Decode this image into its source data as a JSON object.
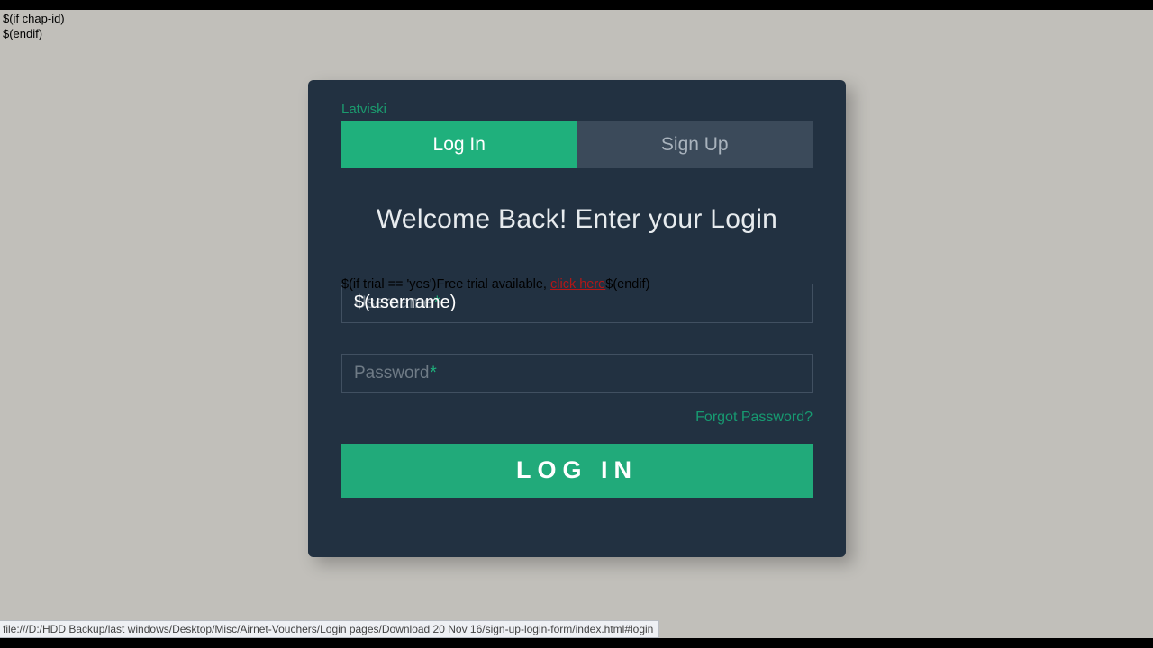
{
  "debug": {
    "line1": "$(if chap-id)",
    "line2": "$(endif)"
  },
  "language_link": "Latviski",
  "tabs": {
    "login": "Log In",
    "signup": "Sign Up"
  },
  "heading": "Welcome Back! Enter your Login",
  "trial": {
    "prefix": "$(if trial == 'yes')Free trial available, ",
    "link": "click here",
    "suffix": "$(endif)"
  },
  "fields": {
    "username": {
      "placeholder": "Username",
      "value": "$(username)"
    },
    "password": {
      "placeholder": "Password",
      "value": ""
    }
  },
  "forgot": "Forgot Password?",
  "login_button": "LOG IN",
  "status_bar": "file:///D:/HDD Backup/last windows/Desktop/Misc/Airnet-Vouchers/Login pages/Download 20 Nov 16/sign-up-login-form/index.html#login"
}
